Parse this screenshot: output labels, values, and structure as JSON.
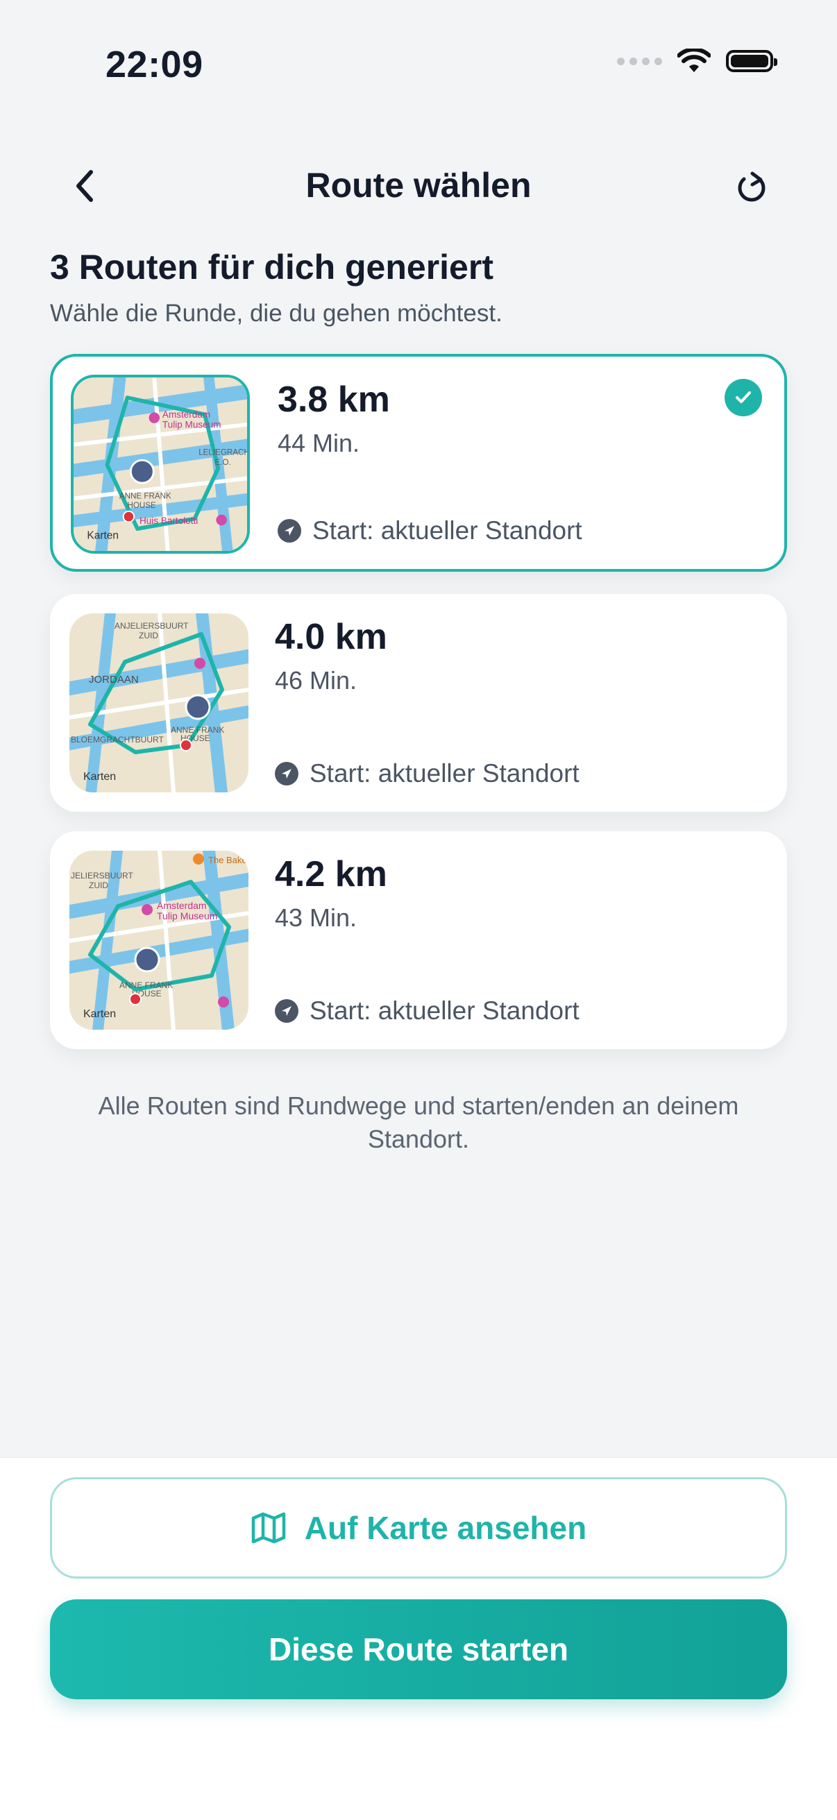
{
  "status": {
    "time": "22:09"
  },
  "nav": {
    "title": "Route wählen",
    "back_icon": "chevron-left-icon",
    "refresh_icon": "refresh-icon"
  },
  "header": {
    "headline": "3 Routen für dich generiert",
    "subline": "Wähle die Runde, die du gehen möchtest."
  },
  "routes": [
    {
      "distance": "3.8 km",
      "duration": "44 Min.",
      "start": "Start: aktueller Standort",
      "selected": true,
      "map_labels": [
        "Amsterdam",
        "Tulip Museum",
        "LELIEGRACHT",
        "E.O.",
        "ANNE FRANK",
        "HOUSE",
        "Huis Bartolotti",
        "Karten"
      ]
    },
    {
      "distance": "4.0 km",
      "duration": "46 Min.",
      "start": "Start: aktueller Standort",
      "selected": false,
      "map_labels": [
        "ANJELIERSBUURT",
        "ZUID",
        "JORDAAN",
        "ANNE FRANK",
        "HOUSE",
        "BLOEMGRACHTBUURT",
        "Karten"
      ]
    },
    {
      "distance": "4.2 km",
      "duration": "43 Min.",
      "start": "Start: aktueller Standort",
      "selected": false,
      "map_labels": [
        "JELIERSBUURT",
        "ZUID",
        "Amsterdam",
        "Tulip Museum",
        "The Bakery",
        "ANNE FRANK",
        "HOUSE",
        "Karten"
      ]
    }
  ],
  "note": "Alle Routen sind Rundwege und starten/enden an deinem Standort.",
  "actions": {
    "map_button": "Auf Karte ansehen",
    "start_button": "Diese Route starten"
  },
  "colors": {
    "accent": "#1fb4aa",
    "text": "#141b2b",
    "muted": "#4b5563",
    "background": "#f2f4f5"
  }
}
